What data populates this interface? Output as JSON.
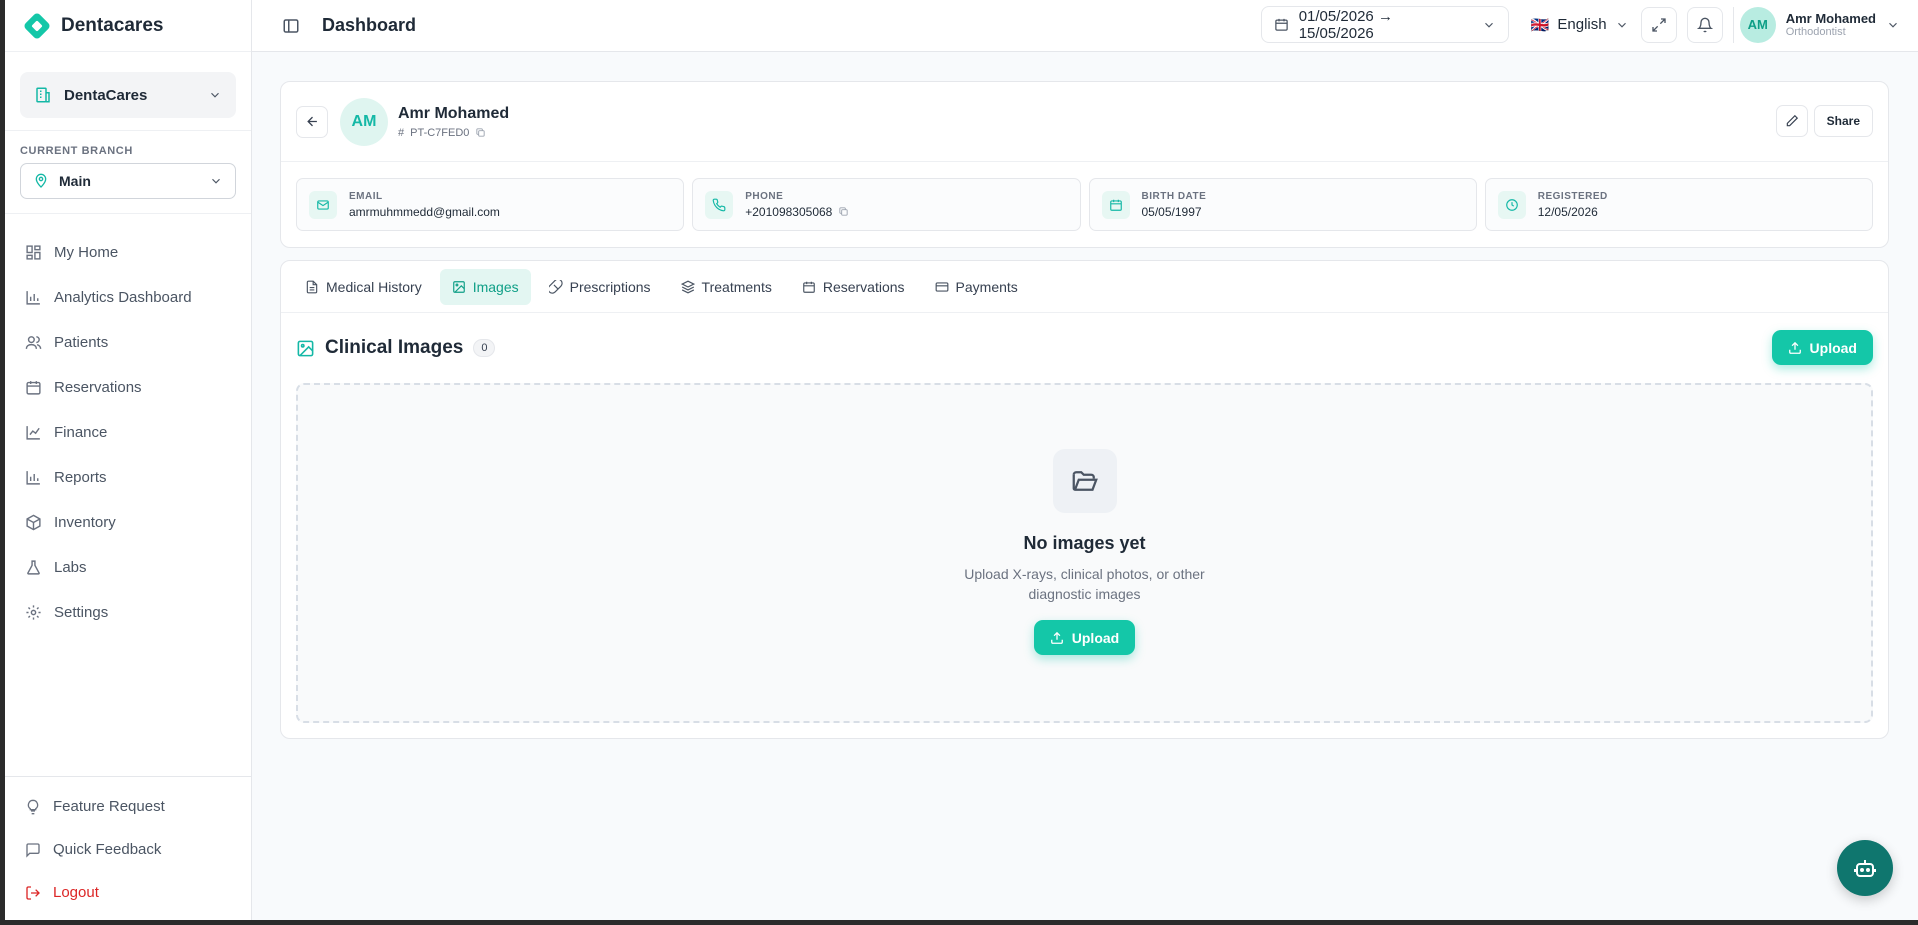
{
  "brand": {
    "name": "Dentacares",
    "color": "#14c7a8"
  },
  "org": {
    "name": "DentaCares"
  },
  "branch": {
    "caption": "CURRENT BRANCH",
    "name": "Main"
  },
  "nav": {
    "items": [
      {
        "label": "My Home",
        "icon": "home-grid-icon"
      },
      {
        "label": "Analytics Dashboard",
        "icon": "bar-chart-icon"
      },
      {
        "label": "Patients",
        "icon": "users-icon"
      },
      {
        "label": "Reservations",
        "icon": "calendar-icon"
      },
      {
        "label": "Finance",
        "icon": "line-chart-icon"
      },
      {
        "label": "Reports",
        "icon": "bar-chart-icon"
      },
      {
        "label": "Inventory",
        "icon": "box-icon"
      },
      {
        "label": "Labs",
        "icon": "flask-icon"
      },
      {
        "label": "Settings",
        "icon": "gear-icon"
      }
    ]
  },
  "bottom": {
    "feature": "Feature Request",
    "feedback": "Quick Feedback",
    "logout": "Logout"
  },
  "topbar": {
    "title": "Dashboard",
    "date_range": "01/05/2026 → 15/05/2026",
    "language": "English",
    "user_name": "Amr Mohamed",
    "user_role": "Orthodontist",
    "user_initials": "AM"
  },
  "patient": {
    "initials": "AM",
    "name": "Amr Mohamed",
    "code": "PT-C7FED0",
    "share": "Share",
    "email_label": "EMAIL",
    "email": "amrmuhmmedd@gmail.com",
    "phone_label": "PHONE",
    "phone": "+201098305068",
    "birth_label": "BIRTH DATE",
    "birth": "05/05/1997",
    "registered_label": "REGISTERED",
    "registered": "12/05/2026"
  },
  "tabs": [
    {
      "label": "Medical History"
    },
    {
      "label": "Images"
    },
    {
      "label": "Prescriptions"
    },
    {
      "label": "Treatments"
    },
    {
      "label": "Reservations"
    },
    {
      "label": "Payments"
    }
  ],
  "images": {
    "title": "Clinical Images",
    "count": "0",
    "upload": "Upload",
    "empty_title": "No images yet",
    "empty_sub": "Upload X-rays, clinical photos, or other diagnostic images"
  }
}
